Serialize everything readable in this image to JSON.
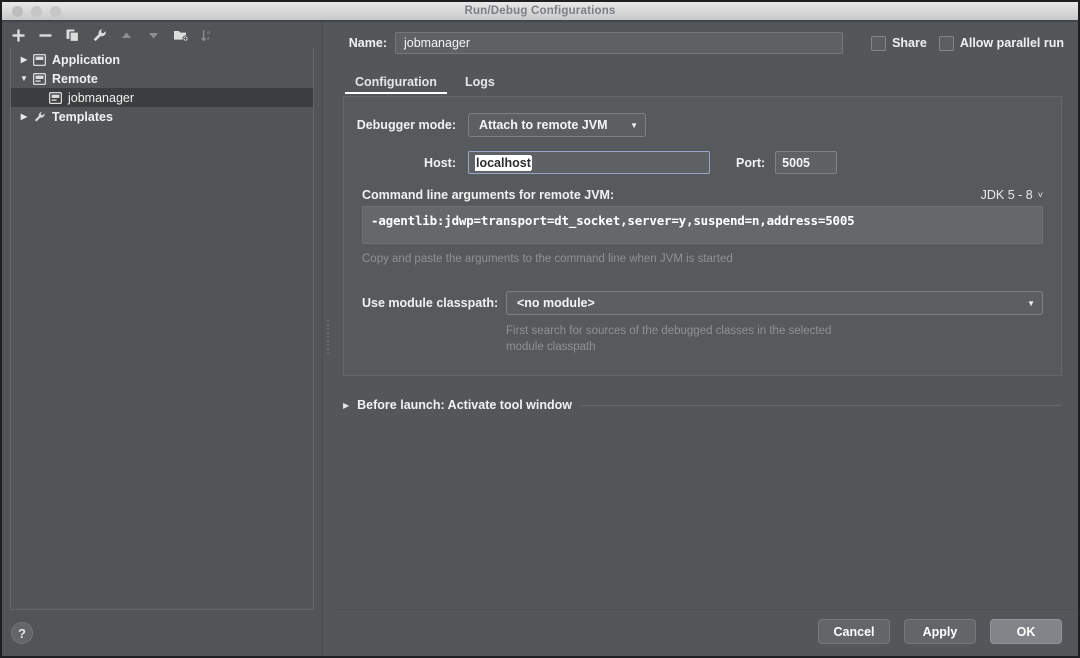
{
  "window": {
    "title": "Run/Debug Configurations"
  },
  "left_panel": {
    "toolbar": [
      {
        "name": "add-button",
        "glyph": "plus",
        "enabled": true
      },
      {
        "name": "remove-button",
        "glyph": "minus",
        "enabled": true
      },
      {
        "name": "copy-button",
        "glyph": "copy",
        "enabled": true
      },
      {
        "name": "edit-templates-button",
        "glyph": "wrench",
        "enabled": true
      },
      {
        "name": "move-up-button",
        "glyph": "triangle-up",
        "enabled": false
      },
      {
        "name": "move-down-button",
        "glyph": "triangle-down",
        "enabled": false
      },
      {
        "name": "create-folder-button",
        "glyph": "folder",
        "enabled": true
      },
      {
        "name": "sort-button",
        "glyph": "sort-az",
        "enabled": false
      }
    ],
    "tree": [
      {
        "label": "Application",
        "expanded": false,
        "level": 0,
        "icon": "app-config-icon",
        "selected": false
      },
      {
        "label": "Remote",
        "expanded": true,
        "level": 0,
        "icon": "remote-config-icon",
        "selected": false
      },
      {
        "label": "jobmanager",
        "expanded": null,
        "level": 1,
        "icon": "remote-config-icon",
        "selected": true
      },
      {
        "label": "Templates",
        "expanded": false,
        "level": 0,
        "icon": "wrench-icon",
        "selected": false
      }
    ],
    "help_label": "?"
  },
  "header": {
    "name_label": "Name:",
    "name_value": "jobmanager",
    "share_label": "Share",
    "share_checked": false,
    "parallel_label": "Allow parallel run",
    "parallel_checked": false
  },
  "tabs": [
    {
      "label": "Configuration",
      "active": true
    },
    {
      "label": "Logs",
      "active": false
    }
  ],
  "configuration": {
    "debugger_mode_label": "Debugger mode:",
    "debugger_mode_value": "Attach to remote JVM",
    "host_label": "Host:",
    "host_value": "localhost",
    "port_label": "Port:",
    "port_value": "5005",
    "cmd_label": "Command line arguments for remote JVM:",
    "jdk_selector": "JDK 5 - 8",
    "cmd_value": "-agentlib:jdwp=transport=dt_socket,server=y,suspend=n,address=5005",
    "cmd_hint": "Copy and paste the arguments to the command line when JVM is started",
    "module_label": "Use module classpath:",
    "module_value": "<no module>",
    "module_hint_line1": "First search for sources of the debugged classes in the selected",
    "module_hint_line2": "module classpath"
  },
  "before_launch": {
    "label": "Before launch: Activate tool window",
    "expanded": false
  },
  "footer": {
    "cancel_label": "Cancel",
    "apply_label": "Apply",
    "ok_label": "OK"
  }
}
